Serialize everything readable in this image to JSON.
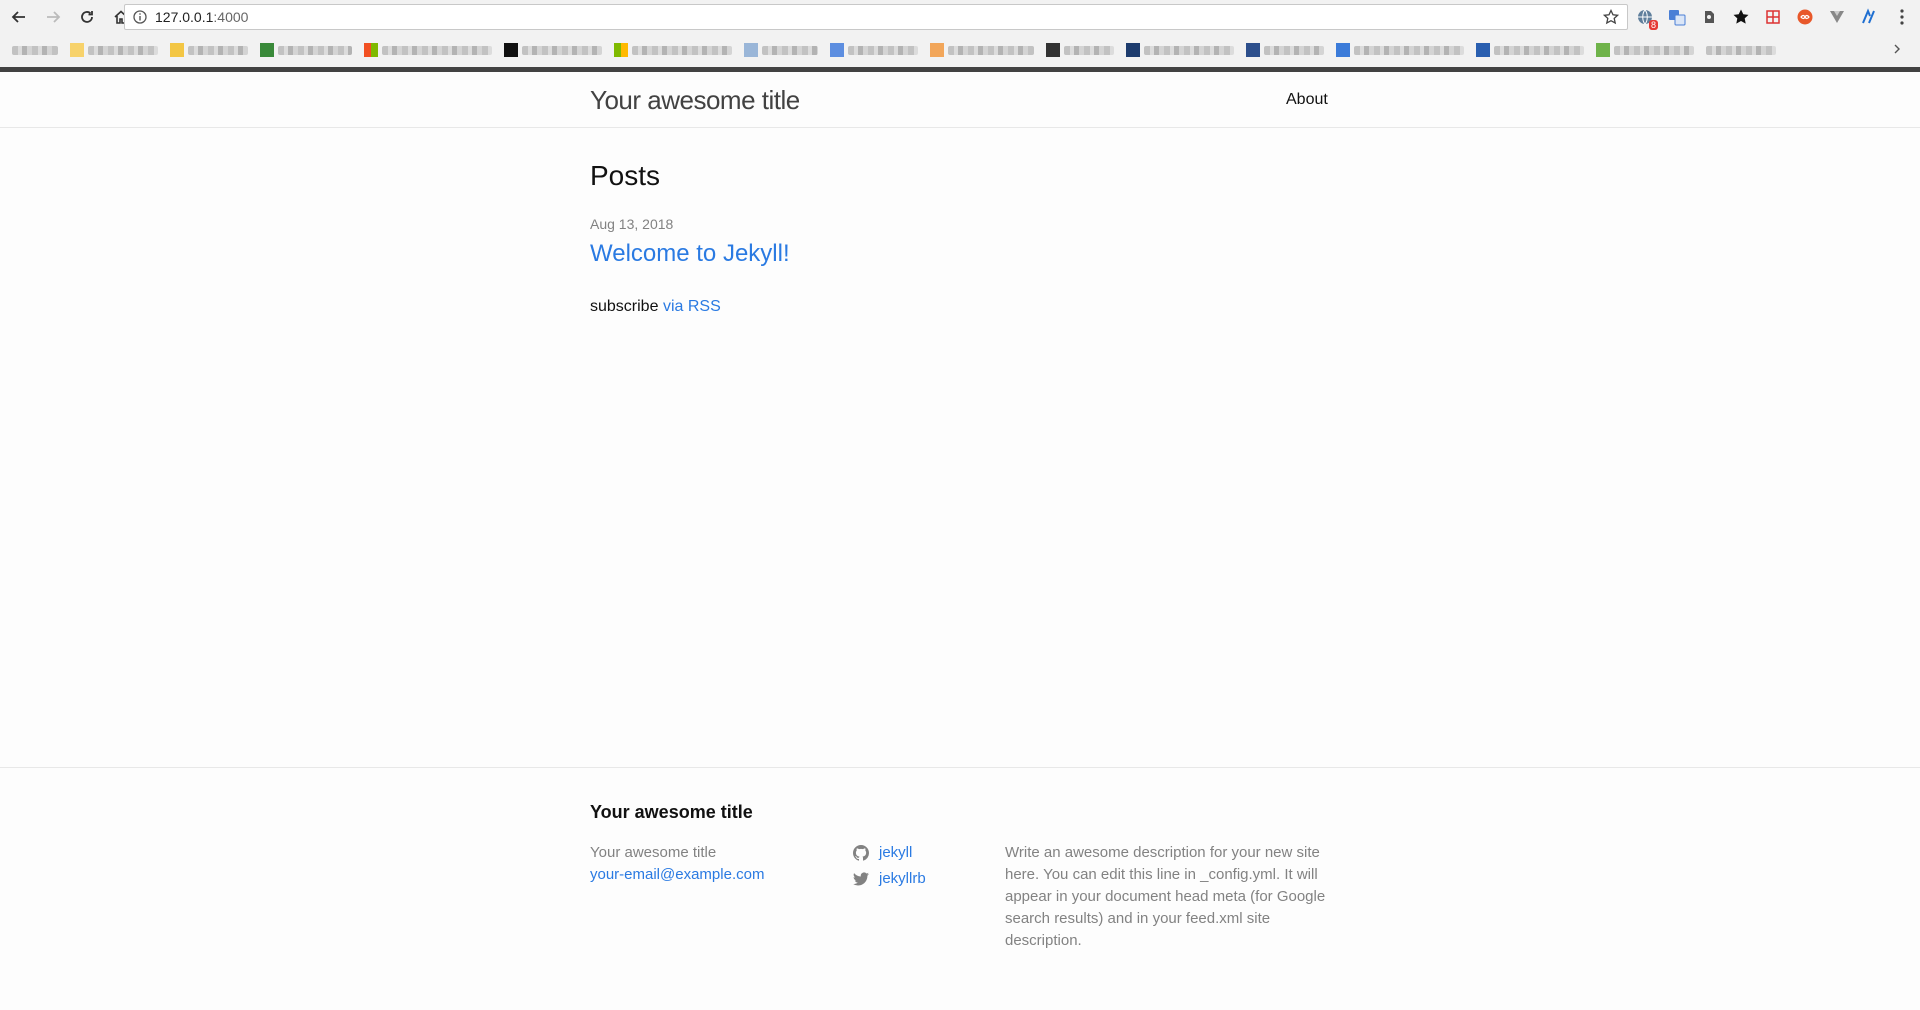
{
  "browser": {
    "url_host": "127.0.0.1",
    "url_port": ":4000",
    "extension_badge": "8"
  },
  "header": {
    "site_title": "Your awesome title",
    "nav": [
      {
        "label": "About"
      }
    ]
  },
  "main": {
    "heading": "Posts",
    "posts": [
      {
        "date": "Aug 13, 2018",
        "title": "Welcome to Jekyll!"
      }
    ],
    "rss_prefix": "subscribe",
    "rss_link": "via RSS"
  },
  "footer": {
    "heading": "Your awesome title",
    "site_name": "Your awesome title",
    "email": "your-email@example.com",
    "github_username": "jekyll",
    "twitter_username": "jekyllrb",
    "description": "Write an awesome description for your new site here. You can edit this line in _config.yml. It will appear in your document head meta (for Google search results) and in your feed.xml site description."
  },
  "colors": {
    "link": "#2a7ae2",
    "meta_text": "#828282",
    "chrome_bar": "#424242"
  }
}
